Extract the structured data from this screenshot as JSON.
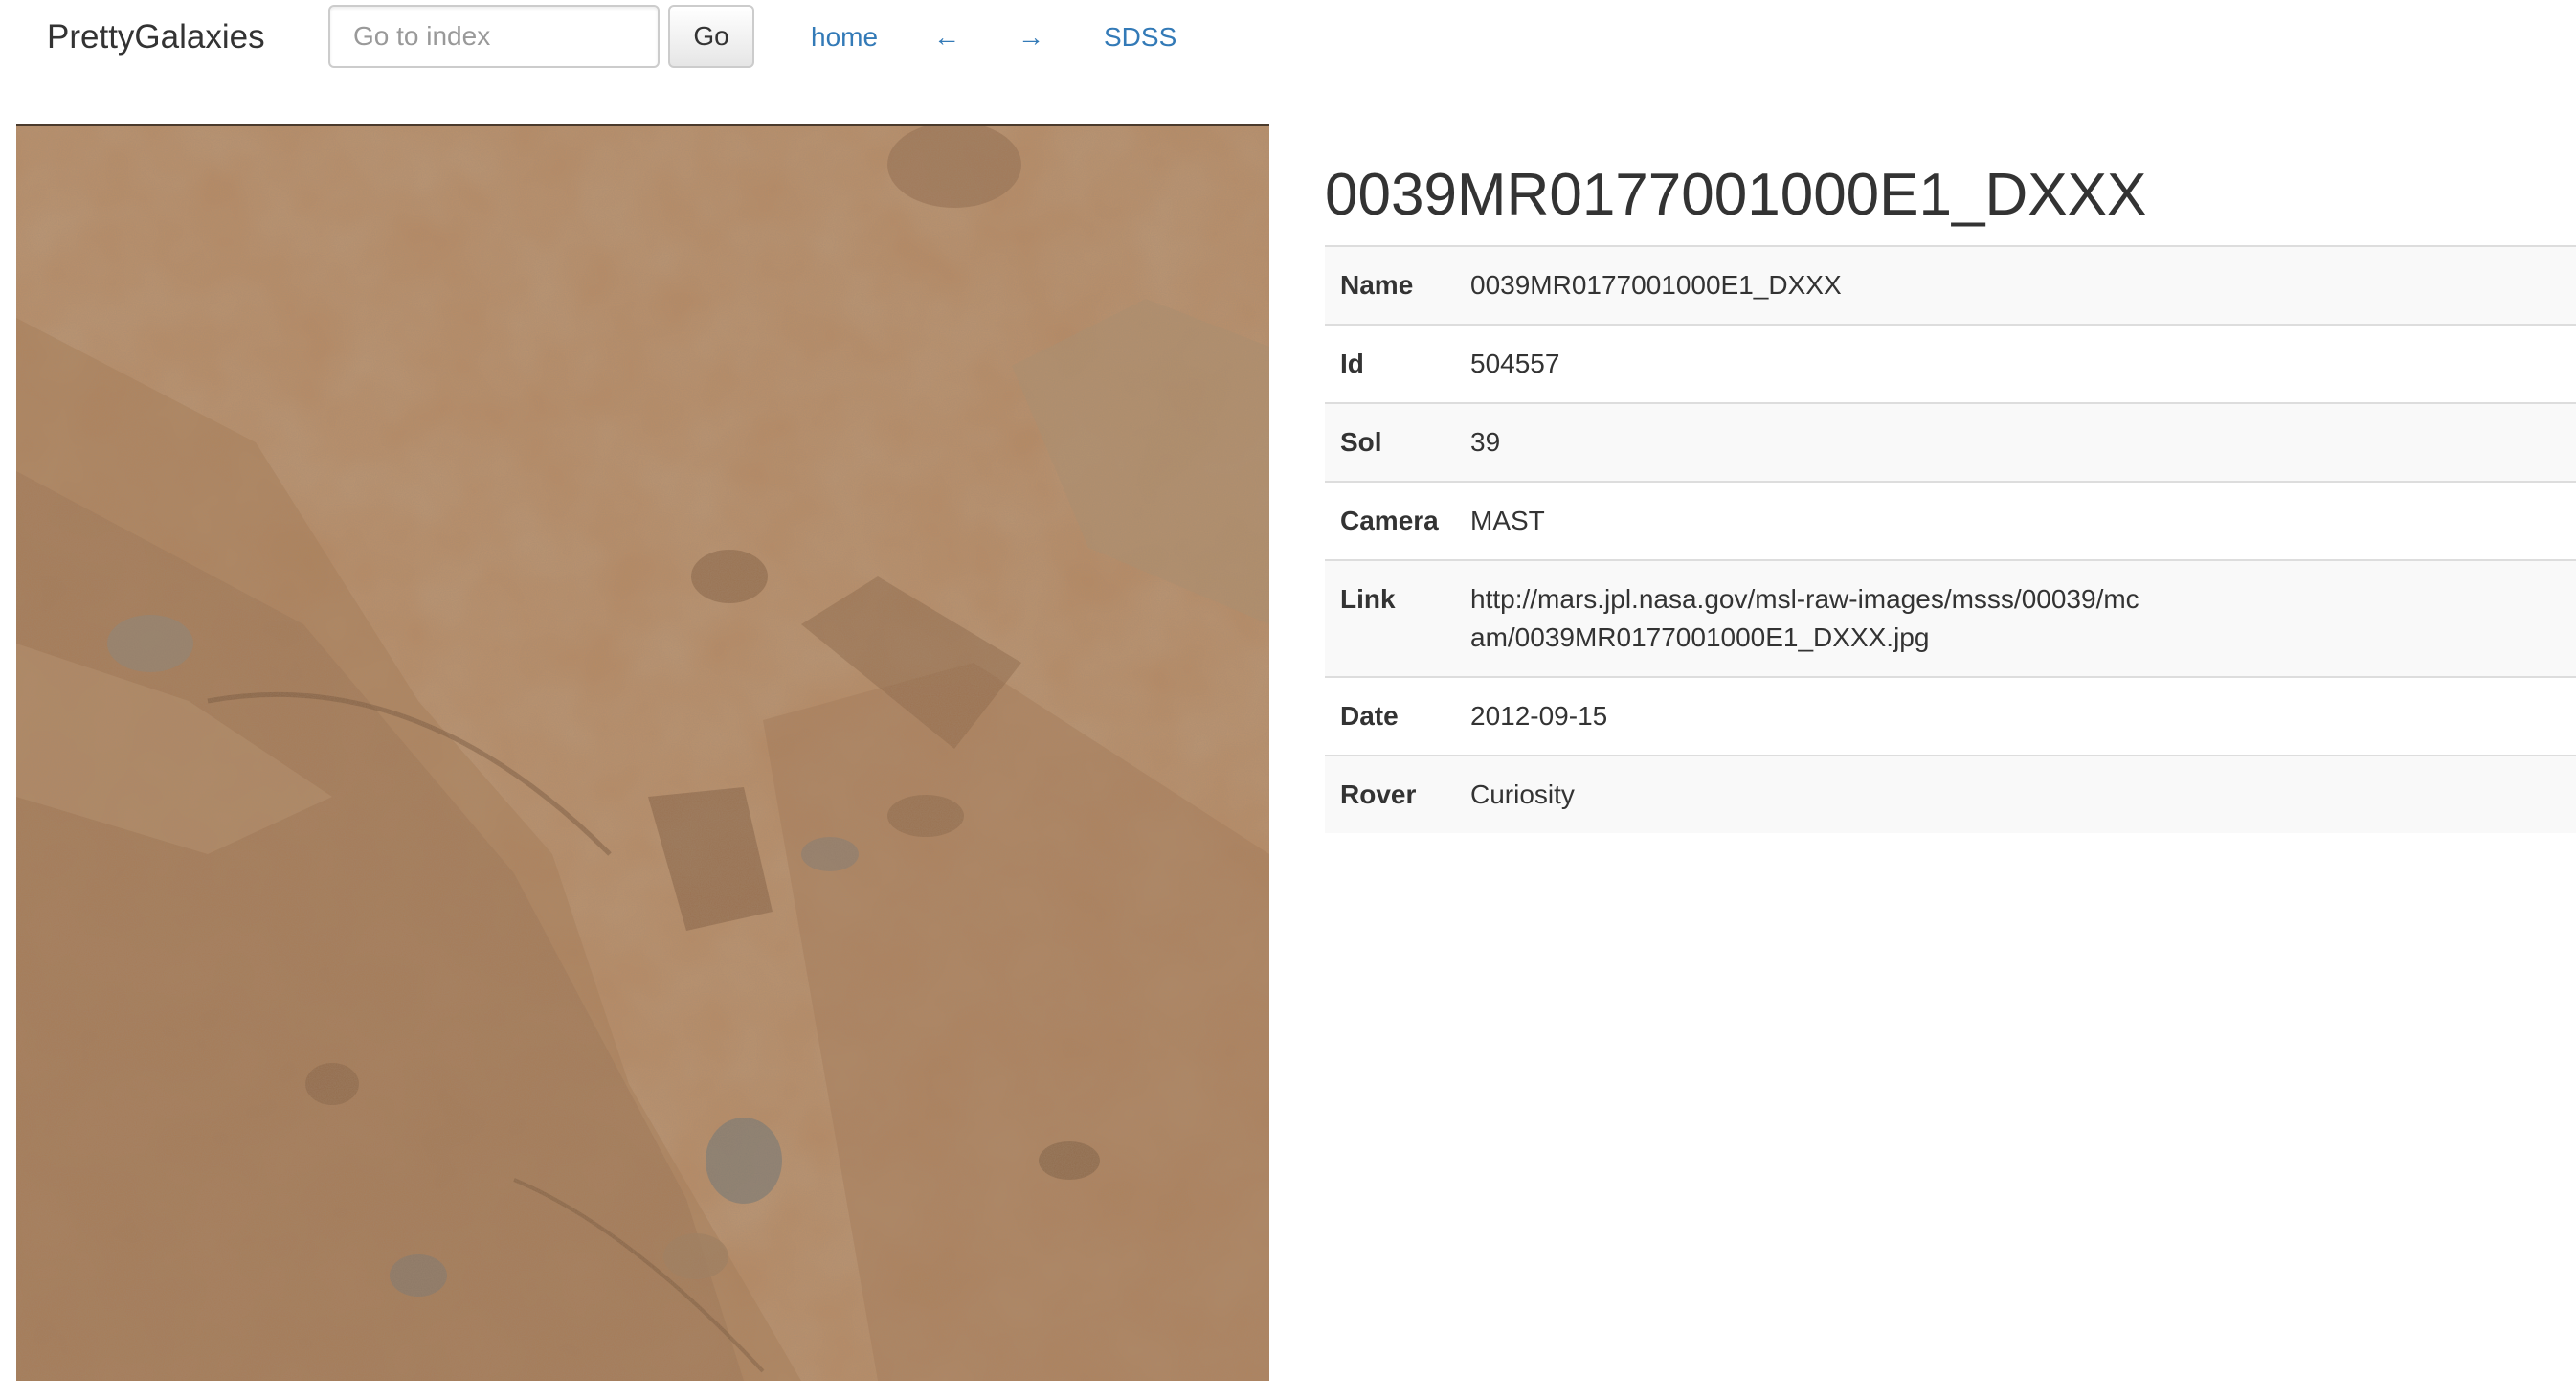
{
  "navbar": {
    "brand": "PrettyGalaxies",
    "search_placeholder": "Go to index",
    "go_label": "Go",
    "links": {
      "home": "home",
      "prev": "←",
      "next": "→",
      "sdss": "SDSS"
    }
  },
  "image": {
    "name": "0039MR0177001000E1_DXXX",
    "colors": {
      "base": "#b8875e",
      "light": "#c99b70",
      "dark": "#8e6542",
      "grey_rock": "#8f8a80"
    }
  },
  "details": {
    "title": "0039MR0177001000E1_DXXX",
    "rows": [
      {
        "key": "Name",
        "value": "0039MR0177001000E1_DXXX"
      },
      {
        "key": "Id",
        "value": "504557"
      },
      {
        "key": "Sol",
        "value": "39"
      },
      {
        "key": "Camera",
        "value": "MAST"
      },
      {
        "key": "Link",
        "value": "http://mars.jpl.nasa.gov/msl-raw-images/msss/00039/mcam/0039MR0177001000E1_DXXX.jpg"
      },
      {
        "key": "Date",
        "value": "2012-09-15"
      },
      {
        "key": "Rover",
        "value": "Curiosity"
      }
    ]
  }
}
